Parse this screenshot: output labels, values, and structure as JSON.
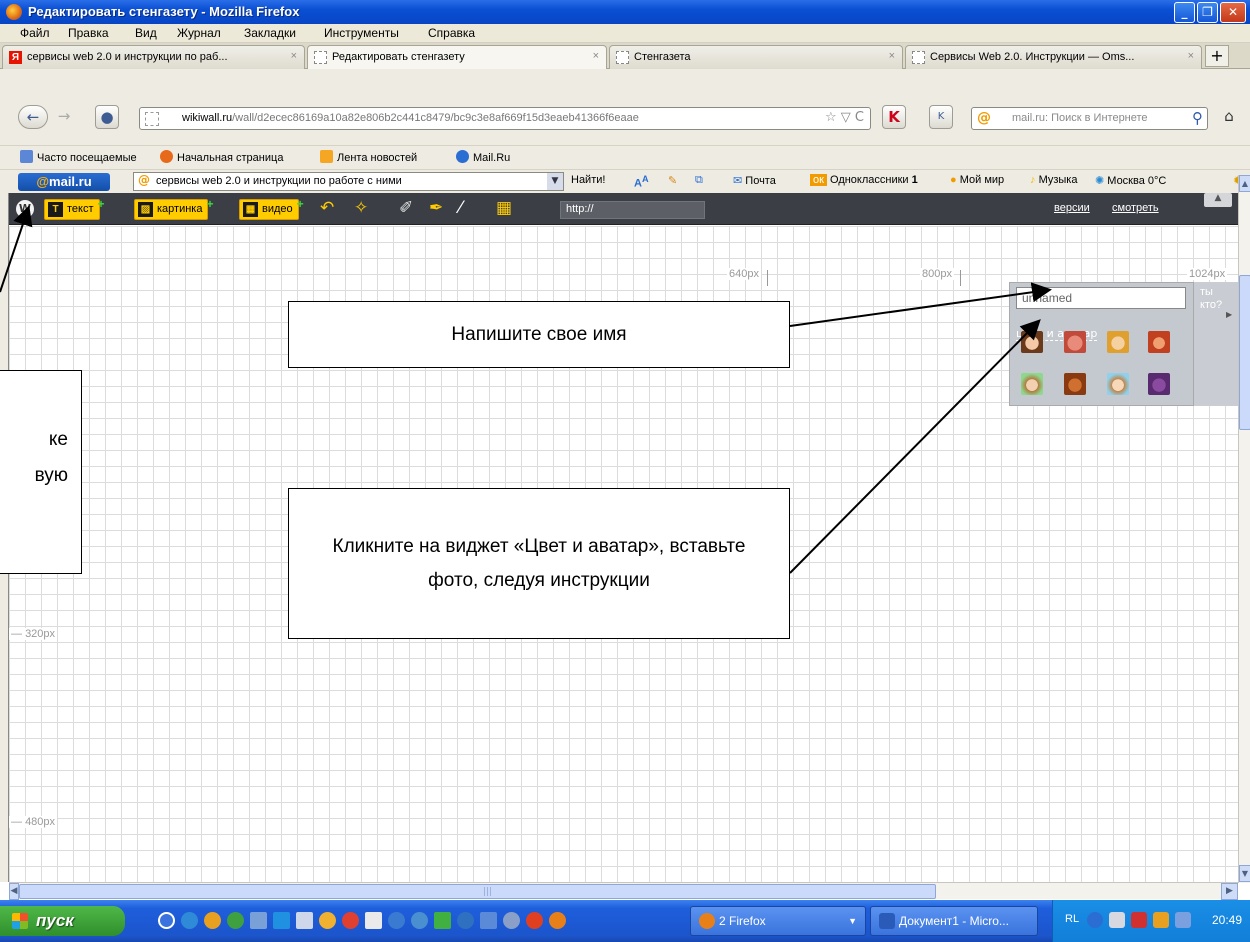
{
  "window": {
    "title": "Редактировать стенгазету - Mozilla Firefox",
    "minimize": "_",
    "maximize": "❐",
    "close": "✕"
  },
  "menu": [
    "Файл",
    "Правка",
    "Вид",
    "Журнал",
    "Закладки",
    "Инструменты",
    "Справка"
  ],
  "tabs": [
    {
      "label": "сервисы web 2.0 и инструкции по раб...",
      "icon": "Я",
      "close": "×"
    },
    {
      "label": "Редактировать стенгазету",
      "icon": "",
      "close": "×"
    },
    {
      "label": "Стенгазета",
      "icon": "",
      "close": "×"
    },
    {
      "label": "Сервисы Web 2.0. Инструкции — Oms...",
      "icon": "",
      "close": "×"
    }
  ],
  "new_tab": "+",
  "nav": {
    "url_host": "wikiwall.ru",
    "url_path": "/wall/d2ecec86169a10a82e806b2c441c8479/bc9c3e8af669f15d3eaeb41366f6eaae",
    "url_controls": "☆ ▽ C",
    "search_icon": "@",
    "search_placeholder": "mail.ru: Поиск в Интернете",
    "search_go": "⚲",
    "back": "←",
    "forward": "→",
    "home": "⌂"
  },
  "bookmarks": [
    {
      "label": "Часто посещаемые",
      "color": "#5b87d6"
    },
    {
      "label": "Начальная страница",
      "color": "#e66a1a"
    },
    {
      "label": "Лента новостей",
      "color": "#f5a623"
    },
    {
      "label": "Mail.Ru",
      "color": "#2a6dd3"
    }
  ],
  "mailru": {
    "logo_at": "@",
    "logo_text": "mail.ru",
    "query": "сервисы web 2.0 и инструкции по работе с ними",
    "find": "Найти!",
    "mail": "Почта",
    "ok": "Одноклассники",
    "ok_count": "1",
    "mymir": "Мой мир",
    "music": "Музыка",
    "weather": "Москва 0°C"
  },
  "wikibar": {
    "logo": "W",
    "text_btn": "текст",
    "image_btn": "картинка",
    "video_btn": "видео",
    "url_value": "http://",
    "versions": "версии",
    "view": "смотреть"
  },
  "rulers": {
    "x_640": "640px",
    "x_800": "800px",
    "x_1024": "1024px",
    "y_320": "320px",
    "y_480": "480px"
  },
  "user_widget": {
    "name_value": "unnamed",
    "color_avatar_link": "цвет и аватар",
    "who": "ты кто?",
    "avatars": [
      "face-1",
      "face-2",
      "face-3",
      "face-4",
      "face-5",
      "face-6",
      "face-7",
      "face-8"
    ]
  },
  "callouts": {
    "name": "Напишите свое имя",
    "avatar": "Кликните на виджет «Цвет и аватар», вставьте фото, следуя инструкции",
    "left_frag1": "ке",
    "left_frag2": "вую"
  },
  "taskbar": {
    "start": "пуск",
    "firefox": "2 Firefox",
    "word": "Документ1 - Micro...",
    "lang": "RL",
    "clock": "20:49"
  }
}
